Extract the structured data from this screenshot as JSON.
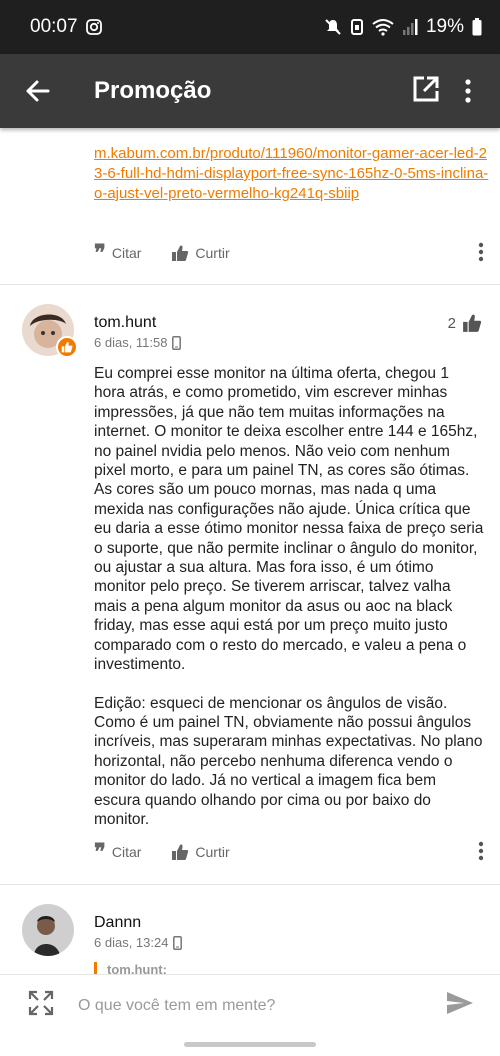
{
  "status_bar": {
    "time": "00:07",
    "battery": "19%"
  },
  "app_bar": {
    "title": "Promoção"
  },
  "previous_post": {
    "link_text": "m.kabum.com.br/produto/111960/monitor-gamer-acer-led-23-6-full-hd-hdmi-displayport-free-sync-165hz-0-5ms-inclina-o-ajust-vel-preto-vermelho-kg241q-sbiip",
    "quote_label": "Citar",
    "like_label": "Curtir"
  },
  "comment": {
    "author": "tom.hunt",
    "time": "6 dias, 11:58",
    "likes": "2",
    "paragraphs": [
      "Eu comprei esse monitor na última oferta, chegou 1 hora atrás, e como prometido, vim escrever minhas impressões, já que não tem muitas informações na internet. O monitor te deixa escolher entre 144 e 165hz, no painel nvidia pelo menos. Não veio com nenhum pixel morto, e para um painel TN, as cores são ótimas. As cores são um pouco mornas, mas nada q uma mexida nas configurações não ajude. Única crítica que eu daria a esse ótimo monitor nessa faixa de preço seria o suporte, que não permite inclinar o ângulo do monitor, ou ajustar a sua altura. Mas fora isso, é um ótimo monitor pelo preço. Se tiverem arriscar, talvez valha mais a pena algum monitor da asus ou aoc na black friday, mas esse aqui está por um preço muito justo comparado com o resto do mercado, e valeu a pena o investimento.",
      "Edição: esqueci de mencionar os ângulos de visão. Como é um painel TN, obviamente não possui ângulos incríveis, mas superaram minhas expectativas. No plano horizontal, não percebo nenhuma diferenca vendo o monitor do lado. Já no vertical a imagem fica bem escura quando olhando por cima ou por baixo do monitor."
    ],
    "quote_label": "Citar",
    "like_label": "Curtir"
  },
  "next_comment": {
    "author": "Dannn",
    "time": "6 dias, 13:24",
    "quote_preview": "tom.hunt:"
  },
  "composer": {
    "placeholder": "O que você tem em mente?"
  },
  "colors": {
    "accent": "#ef7c00",
    "app_bar": "#3a3a3a",
    "status_bar": "#1f1f1f"
  }
}
